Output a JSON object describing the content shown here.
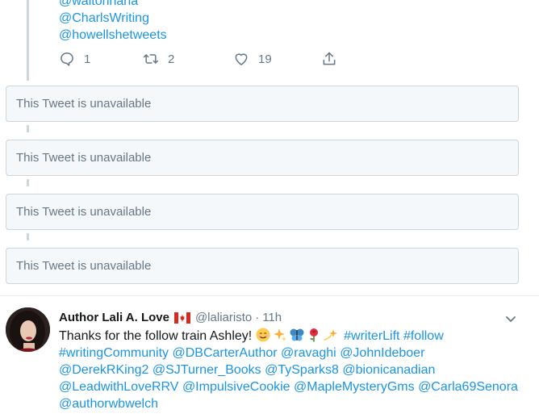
{
  "top_tweet": {
    "mentions": [
      "@waltonhana",
      "@CharlsWriting",
      "@howellshetweets"
    ],
    "actions": {
      "reply_count": "1",
      "retweet_count": "2",
      "like_count": "19"
    }
  },
  "unavailable_text": "This Tweet is unavailable",
  "unavailable_tweets": [
    {
      "text": "This Tweet is unavailable"
    },
    {
      "text": "This Tweet is unavailable"
    },
    {
      "text": "This Tweet is unavailable"
    },
    {
      "text": "This Tweet is unavailable"
    }
  ],
  "bottom_tweet": {
    "display_name": "Author Lali A. Love",
    "flag": "canada-flag-icon",
    "handle": "@laliaristo",
    "separator": "·",
    "time": "11h",
    "text_intro": "Thanks for the follow train Ashley!",
    "emojis": [
      "smiling-face-icon",
      "sparkles-icon",
      "butterfly-icon",
      "rose-icon",
      "dizzy-icon"
    ],
    "line1_tags": [
      "#writerLift",
      "#follow"
    ],
    "line2": [
      "#writingCommunity",
      "@DBCarterAuthor",
      "@ravaghi",
      "@JohnIdeboer"
    ],
    "line3": [
      "@DerekRKing2",
      "@SJTurner_Books",
      "@TySparks8",
      "@bionicanadian"
    ],
    "line4": [
      "@LeadwithLoveRRV",
      "@ImpulsiveCookie",
      "@MapleMysteryGms",
      "@Carla69Senora"
    ],
    "line5": [
      "@authorwbwelch"
    ]
  },
  "colors": {
    "link": "#1b95e0",
    "muted": "#657786",
    "border": "#ccd6dd",
    "card_bg": "#f5f8fa"
  }
}
